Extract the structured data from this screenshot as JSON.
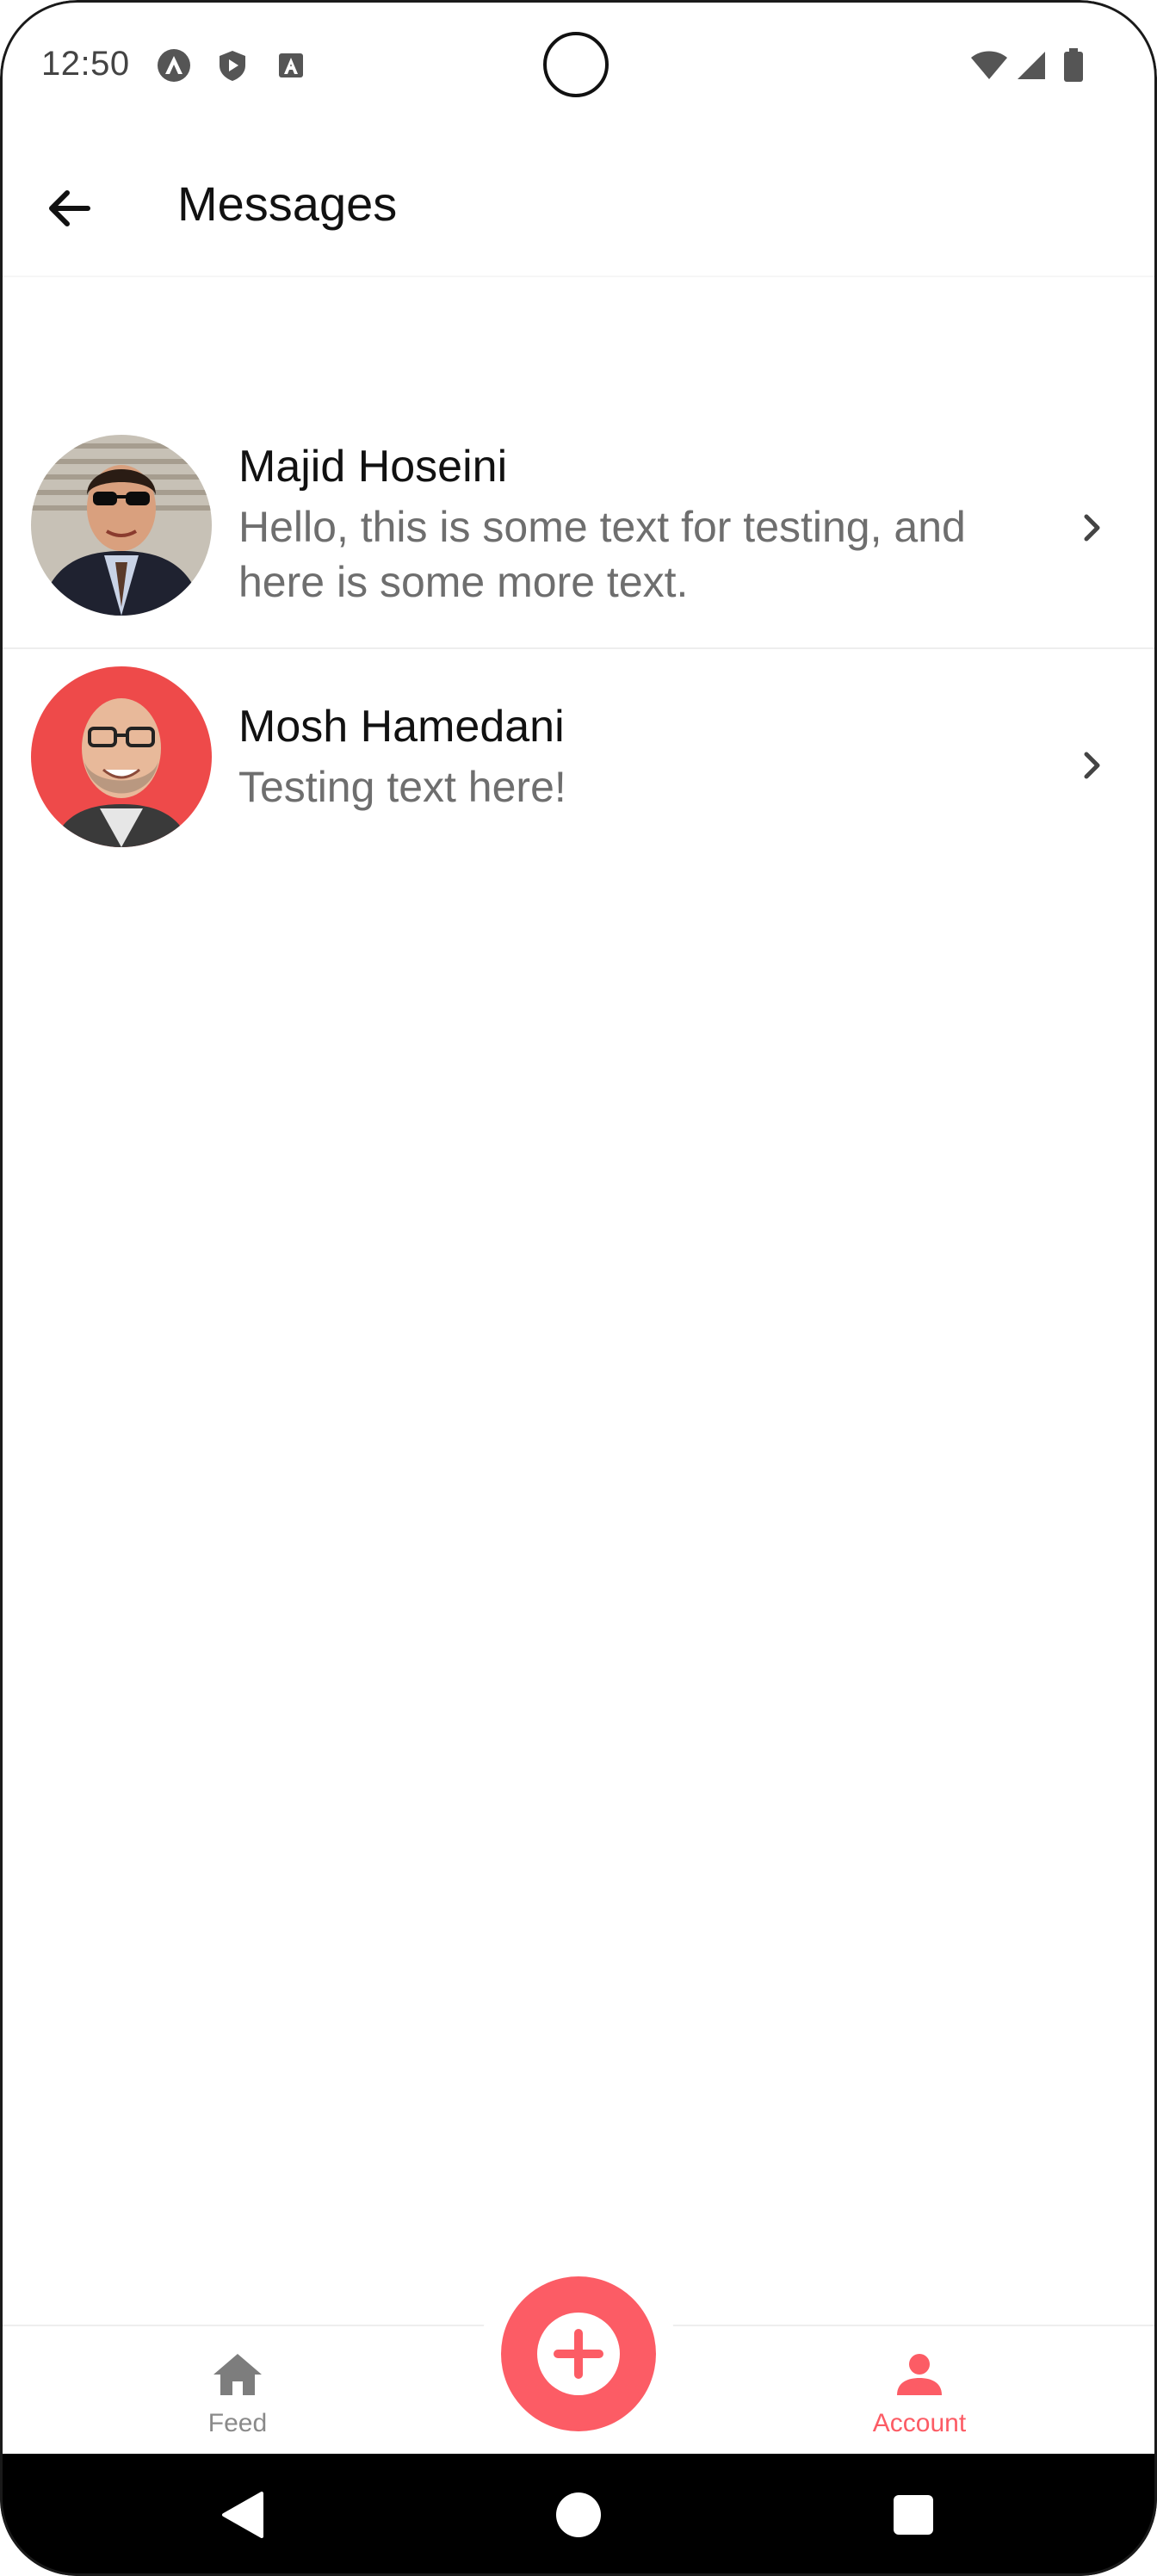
{
  "status_bar": {
    "time": "12:50",
    "left_icons": [
      "android-debug-icon",
      "play-protect-icon",
      "a-badge-icon"
    ],
    "right_icons": [
      "wifi-icon",
      "cellular-signal-icon",
      "battery-icon"
    ]
  },
  "header": {
    "back_icon": "arrow-left-icon",
    "title": "Messages"
  },
  "messages": [
    {
      "name": "Majid Hoseini",
      "text": "Hello, this is some text for testing, and here is some more text.",
      "avatar": "avatar-photo"
    },
    {
      "name": "Mosh Hamedani",
      "text": "Testing text here!",
      "avatar": "avatar-photo"
    }
  ],
  "tabs": {
    "feed_label": "Feed",
    "account_label": "Account",
    "feed_icon": "home-icon",
    "account_icon": "account-icon",
    "fab_icon": "plus-circle-icon"
  },
  "colors": {
    "primary": "#fc5c65",
    "inactive": "#8a8a8a",
    "secondary_text": "#6e6e6e"
  },
  "nav_bar": {
    "icons": [
      "back-triangle-icon",
      "home-circle-icon",
      "recents-square-icon"
    ]
  }
}
